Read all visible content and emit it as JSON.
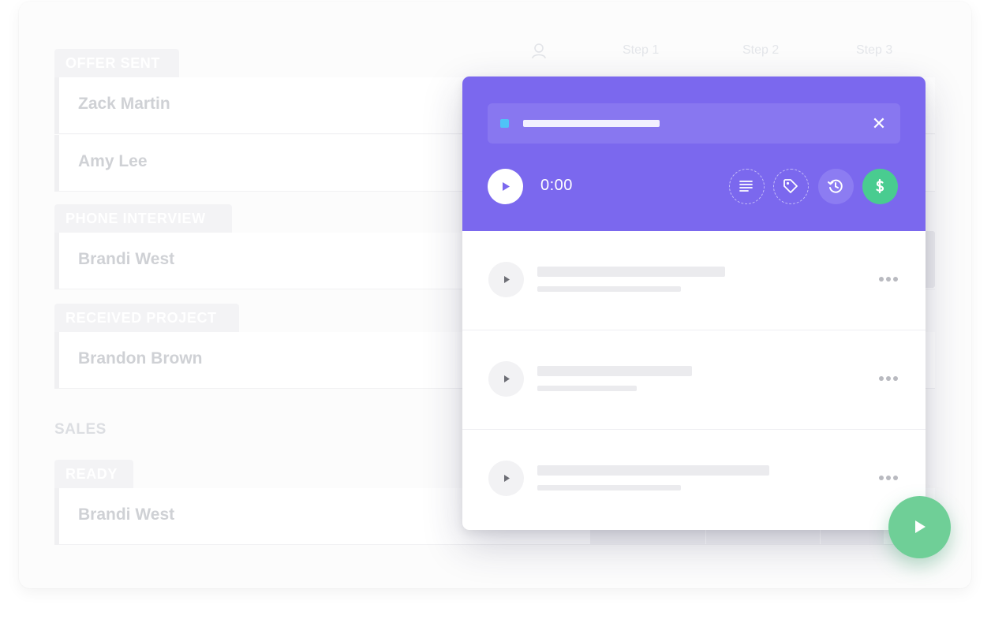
{
  "columns": {
    "step1": "Step 1",
    "step2": "Step 2",
    "step3": "Step 3"
  },
  "groups": [
    {
      "tag": "OFFER SENT",
      "rows": [
        "Zack Martin",
        "Amy Lee"
      ]
    },
    {
      "tag": "PHONE INTERVIEW",
      "rows": [
        "Brandi West"
      ]
    },
    {
      "tag": "RECEIVED PROJECT",
      "rows": [
        "Brandon Brown"
      ]
    }
  ],
  "section": {
    "label": "SALES",
    "groups": [
      {
        "tag": "READY",
        "rows": [
          "Brandi West"
        ]
      }
    ]
  },
  "timer": {
    "display": "0:00",
    "close_glyph": "✕",
    "tools": [
      "notes-icon",
      "tag-icon",
      "history-icon",
      "billable-dollar-icon"
    ]
  },
  "entries_count": 3,
  "colors": {
    "modal_header": "#7b68ee",
    "billable": "#49cc90",
    "fab": "#6fcf97",
    "task_dot": "#4fc3f7"
  }
}
